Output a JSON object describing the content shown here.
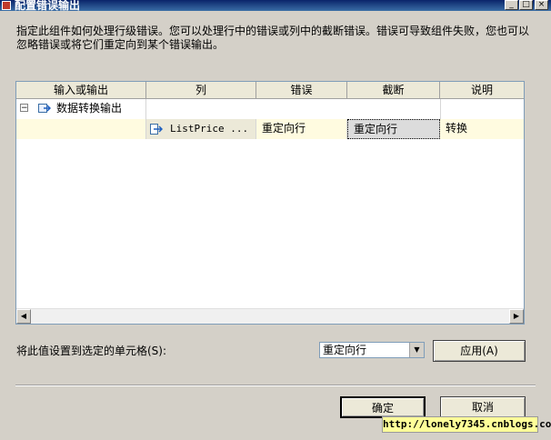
{
  "window": {
    "title": "配置错误输出",
    "minimize": "_",
    "maximize": "□",
    "close": "×"
  },
  "description": "指定此组件如何处理行级错误。您可以处理行中的错误或列中的截断错误。错误可导致组件失败，您也可以忽略错误或将它们重定向到某个错误输出。",
  "grid": {
    "headers": [
      "输入或输出",
      "列",
      "错误",
      "截断",
      "说明"
    ],
    "group_row": {
      "expander": "−",
      "label": "数据转换输出",
      "icon": "transform-output-icon"
    },
    "rows": [
      {
        "column": "ListPrice ...",
        "error": "重定向行",
        "truncation": "重定向行",
        "description": "转换"
      }
    ]
  },
  "set_value": {
    "label": "将此值设置到选定的单元格(S):",
    "selected": "重定向行",
    "apply_button": "应用(A)"
  },
  "footer": {
    "ok": "确定",
    "cancel": "取消"
  },
  "watermark": "http://lonely7345.cnblogs.com/"
}
